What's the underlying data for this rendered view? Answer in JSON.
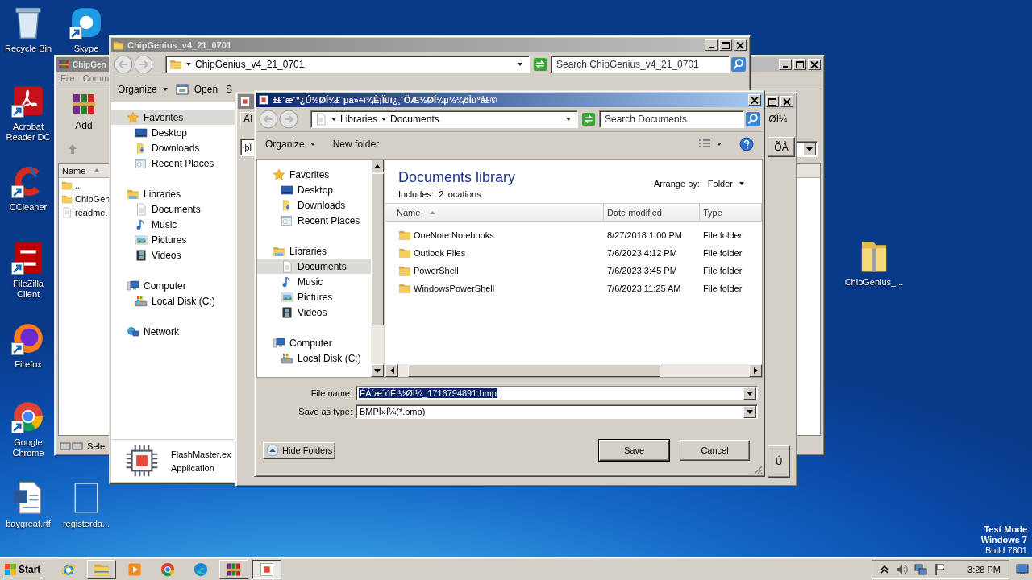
{
  "desktop": {
    "icons": [
      {
        "label": "Recycle Bin",
        "kind": "trash",
        "shortcut": false
      },
      {
        "label": "Skype",
        "kind": "skype",
        "shortcut": true
      },
      {
        "label": "Acrobat Reader DC",
        "kind": "pdf",
        "shortcut": true
      },
      {
        "label": "CCleaner",
        "kind": "ccleaner",
        "shortcut": true
      },
      {
        "label": "FileZilla Client",
        "kind": "filezilla",
        "shortcut": true
      },
      {
        "label": "Firefox",
        "kind": "firefox",
        "shortcut": true
      },
      {
        "label": "Google Chrome",
        "kind": "chrome",
        "shortcut": true
      },
      {
        "label": "baygreat.rtf",
        "kind": "word",
        "shortcut": false
      },
      {
        "label": "registerda...",
        "kind": "blank",
        "shortcut": false
      },
      {
        "label": "ChipGenius_...",
        "kind": "zipfolder",
        "shortcut": false
      }
    ],
    "notice": [
      {
        "text": "Test Mode",
        "bold": true
      },
      {
        "text": "Windows 7",
        "bold": true
      },
      {
        "text": "Build 7601",
        "bold": false
      }
    ]
  },
  "windows": [
    {
      "kind": "winrar",
      "title": "ChipGen",
      "active": false,
      "caption_buttons": [
        {
          "kind": "minimize"
        },
        {
          "kind": "maximize"
        },
        {
          "kind": "close"
        }
      ],
      "menu": [
        "File",
        "Comm"
      ],
      "toolbar": [
        {
          "label": "Add"
        }
      ],
      "list": {
        "column": "Name",
        "rows": [
          {
            "name": "..",
            "kind": "folder"
          },
          {
            "name": "ChipGen",
            "kind": "folder"
          },
          {
            "name": "readme.",
            "kind": "text"
          }
        ]
      },
      "status": "Sele"
    },
    {
      "kind": "explorer",
      "title": "ChipGenius_v4_21_0701",
      "active": false,
      "caption_buttons": [
        {
          "kind": "minimize"
        },
        {
          "kind": "maximize"
        },
        {
          "kind": "close"
        }
      ],
      "address": [
        "ChipGenius_v4_21_0701"
      ],
      "search": {
        "placeholder": "Search ChipGenius_v4_21_0701"
      },
      "toolbar": [
        {
          "label": "Organize",
          "kind": "menu"
        },
        {
          "label": "Open",
          "kind": "open"
        },
        {
          "label": "S",
          "kind": "plain"
        }
      ],
      "nav": [
        {
          "label": "Favorites",
          "kind": "star",
          "selected": true,
          "children": [
            {
              "label": "Desktop",
              "kind": "desktop",
              "selected": false
            },
            {
              "label": "Downloads",
              "kind": "downloads",
              "selected": false
            },
            {
              "label": "Recent Places",
              "kind": "recent",
              "selected": false
            }
          ]
        },
        {
          "label": "Libraries",
          "kind": "library",
          "selected": false,
          "children": [
            {
              "label": "Documents",
              "kind": "documents",
              "selected": false
            },
            {
              "label": "Music",
              "kind": "music",
              "selected": false
            },
            {
              "label": "Pictures",
              "kind": "pictures",
              "selected": false
            },
            {
              "label": "Videos",
              "kind": "videos",
              "selected": false
            }
          ]
        },
        {
          "label": "Computer",
          "kind": "computer",
          "selected": false,
          "children": [
            {
              "label": "Local Disk (C:)",
              "kind": "disk",
              "selected": false
            }
          ]
        },
        {
          "label": "Network",
          "kind": "network",
          "selected": false
        }
      ],
      "details": {
        "name": "FlashMaster.ex",
        "type": "Application"
      }
    },
    {
      "kind": "app_dialog",
      "active": false,
      "caption_buttons": [
        {
          "kind": "maximize"
        },
        {
          "kind": "close"
        }
      ],
      "tab": "ÀÏ",
      "field": "·þÎ",
      "label": "ØÍ¼",
      "button": "ÕÅ",
      "bottom_button": "Ú"
    },
    {
      "kind": "save_dialog",
      "title": "±£´æ´°¿Ú½ØÍ¼£¨µã»÷ï¾È¡Ïûì¿¸´ÖÆ½ØÍ¼µ½¼ôÌù°å£©",
      "active": true,
      "caption_buttons": [
        {
          "kind": "close"
        }
      ],
      "address": [
        "Libraries",
        "Documents"
      ],
      "search": {
        "placeholder": "Search Documents"
      },
      "toolbar": [
        {
          "label": "Organize",
          "kind": "menu"
        },
        {
          "label": "New folder",
          "kind": "plain"
        }
      ],
      "nav": [
        {
          "label": "Favorites",
          "kind": "star",
          "selected": false,
          "children": [
            {
              "label": "Desktop",
              "kind": "desktop",
              "selected": false
            },
            {
              "label": "Downloads",
              "kind": "downloads",
              "selected": false
            },
            {
              "label": "Recent Places",
              "kind": "recent",
              "selected": false
            }
          ]
        },
        {
          "label": "Libraries",
          "kind": "library",
          "selected": false,
          "children": [
            {
              "label": "Documents",
              "kind": "documents",
              "selected": true
            },
            {
              "label": "Music",
              "kind": "music",
              "selected": false
            },
            {
              "label": "Pictures",
              "kind": "pictures",
              "selected": false
            },
            {
              "label": "Videos",
              "kind": "videos",
              "selected": false
            }
          ]
        },
        {
          "label": "Computer",
          "kind": "computer",
          "selected": false,
          "children": [
            {
              "label": "Local Disk (C:)",
              "kind": "disk",
              "selected": false
            }
          ]
        }
      ],
      "library": {
        "heading": "Documents library",
        "includes": "Includes:  2 locations",
        "arrange_label": "Arrange by:",
        "arrange_value": "Folder"
      },
      "columns": [
        {
          "label": "Name",
          "sorted": true
        },
        {
          "label": "Date modified",
          "sorted": false
        },
        {
          "label": "Type",
          "sorted": false
        }
      ],
      "rows": [
        {
          "name": "OneNote Notebooks",
          "date": "8/27/2018 1:00 PM",
          "type": "File folder"
        },
        {
          "name": "Outlook Files",
          "date": "7/6/2023 4:12 PM",
          "type": "File folder"
        },
        {
          "name": "PowerShell",
          "date": "7/6/2023 3:45 PM",
          "type": "File folder"
        },
        {
          "name": "WindowsPowerShell",
          "date": "7/6/2023 11:25 AM",
          "type": "File folder"
        }
      ],
      "fields": [
        {
          "label": "File name:",
          "value": "ÉÁ´æ´óÊ¦½ØÍ¼_1716794891.bmp",
          "selected": true
        },
        {
          "label": "Save as type:",
          "value": "BMPÎ»Í¼(*.bmp)",
          "selected": false
        }
      ],
      "hide_folders": "Hide Folders",
      "buttons": [
        {
          "label": "Save",
          "default": true
        },
        {
          "label": "Cancel",
          "default": false
        }
      ]
    }
  ],
  "taskbar": {
    "start": "Start",
    "apps": [
      {
        "kind": "ie",
        "running": false,
        "active": false
      },
      {
        "kind": "explorer",
        "running": true,
        "active": false
      },
      {
        "kind": "media",
        "running": false,
        "active": false
      },
      {
        "kind": "chrome",
        "running": false,
        "active": false
      },
      {
        "kind": "edge",
        "running": false,
        "active": false
      },
      {
        "kind": "winrar",
        "running": true,
        "active": false
      },
      {
        "kind": "app",
        "running": true,
        "active": true
      }
    ],
    "clock": "3:28 PM"
  }
}
